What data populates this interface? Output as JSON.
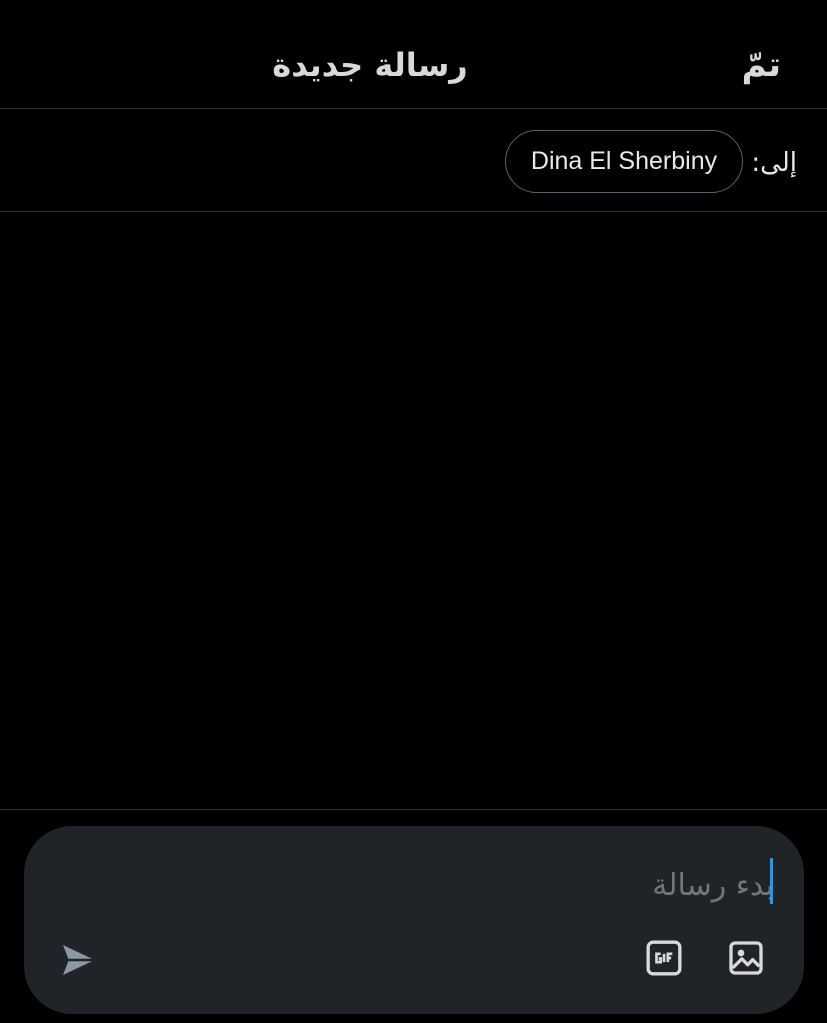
{
  "header": {
    "title": "رسالة جديدة",
    "done_label": "تمّ"
  },
  "recipient": {
    "to_label": "إلى:",
    "name": "Dina El Sherbiny"
  },
  "composer": {
    "placeholder": "بدء رسالة",
    "value": "",
    "gif_icon": "gif-icon",
    "image_icon": "image-icon",
    "send_icon": "send-icon"
  },
  "colors": {
    "background": "#000000",
    "divider": "#2f3336",
    "composer_bg": "#202327",
    "accent": "#1d9bf0",
    "placeholder": "#71767b"
  }
}
